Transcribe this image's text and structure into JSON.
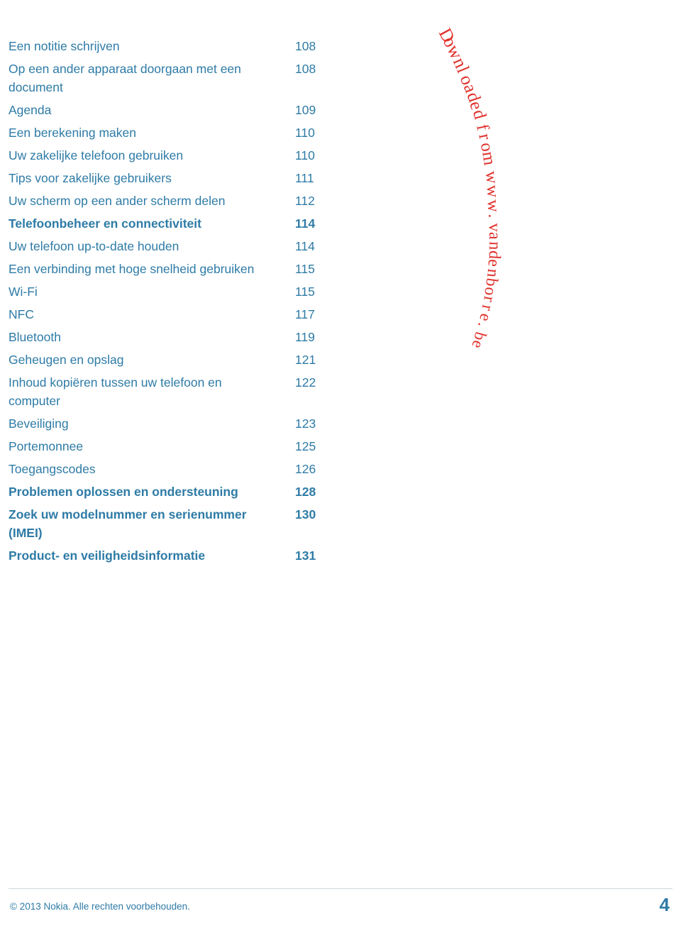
{
  "document": {
    "accent_color": "#2e7ba6",
    "watermark_color": "#e0322c",
    "watermark_text": "Downloaded from www.vandenborre.be",
    "toc": [
      {
        "title": "Een notitie schrijven",
        "page": "108",
        "bold": false
      },
      {
        "title": "Op een ander apparaat doorgaan met een document",
        "page": "108",
        "bold": false
      },
      {
        "title": "Agenda",
        "page": "109",
        "bold": false
      },
      {
        "title": "Een berekening maken",
        "page": "110",
        "bold": false
      },
      {
        "title": "Uw zakelijke telefoon gebruiken",
        "page": "110",
        "bold": false
      },
      {
        "title": "Tips voor zakelijke gebruikers",
        "page": "111",
        "bold": false
      },
      {
        "title": "Uw scherm op een ander scherm delen",
        "page": "112",
        "bold": false
      },
      {
        "title": "Telefoonbeheer en connectiviteit",
        "page": "114",
        "bold": true
      },
      {
        "title": "Uw telefoon up-to-date houden",
        "page": "114",
        "bold": false
      },
      {
        "title": "Een verbinding met hoge snelheid gebruiken",
        "page": "115",
        "bold": false
      },
      {
        "title": "Wi-Fi",
        "page": "115",
        "bold": false
      },
      {
        "title": "NFC",
        "page": "117",
        "bold": false
      },
      {
        "title": "Bluetooth",
        "page": "119",
        "bold": false
      },
      {
        "title": "Geheugen en opslag",
        "page": "121",
        "bold": false
      },
      {
        "title": "Inhoud kopiëren tussen uw telefoon en computer",
        "page": "122",
        "bold": false
      },
      {
        "title": "Beveiliging",
        "page": "123",
        "bold": false
      },
      {
        "title": "Portemonnee",
        "page": "125",
        "bold": false
      },
      {
        "title": "Toegangscodes",
        "page": "126",
        "bold": false
      },
      {
        "title": "Problemen oplossen en ondersteuning",
        "page": "128",
        "bold": true
      },
      {
        "title": "Zoek uw modelnummer en serienummer (IMEI)",
        "page": "130",
        "bold": true
      },
      {
        "title": "Product- en veiligheidsinformatie",
        "page": "131",
        "bold": true
      }
    ],
    "footer": {
      "copyright": "© 2013 Nokia. Alle rechten voorbehouden.",
      "page_number": "4"
    }
  }
}
